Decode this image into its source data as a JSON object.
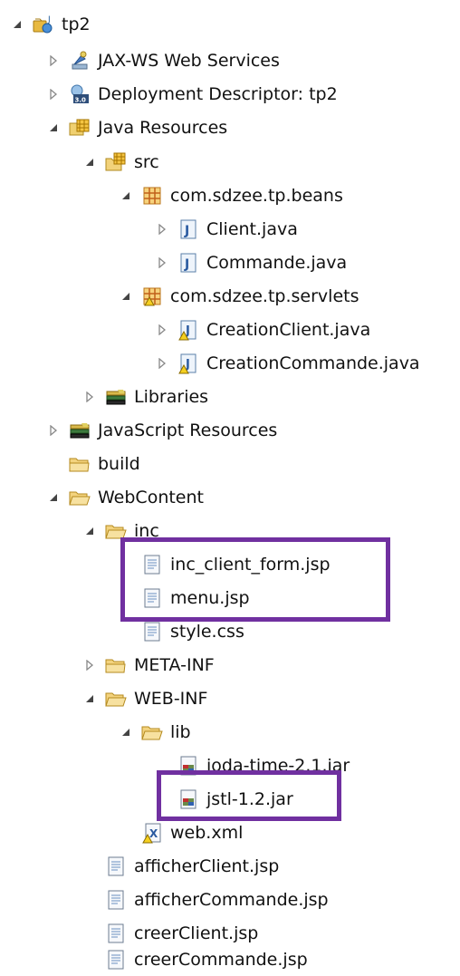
{
  "tree": {
    "project": "tp2",
    "jaxws": "JAX-WS Web Services",
    "deploy": "Deployment Descriptor: tp2",
    "javares": "Java Resources",
    "src": "src",
    "pkg_beans": "com.sdzee.tp.beans",
    "client_java": "Client.java",
    "commande_java": "Commande.java",
    "pkg_servlets": "com.sdzee.tp.servlets",
    "creationclient_java": "CreationClient.java",
    "creationcommande_java": "CreationCommande.java",
    "libraries": "Libraries",
    "jsres": "JavaScript Resources",
    "build": "build",
    "webcontent": "WebContent",
    "inc": "inc",
    "inc_client_form": "inc_client_form.jsp",
    "menu_jsp": "menu.jsp",
    "style_css": "style.css",
    "metainf": "META-INF",
    "webinf": "WEB-INF",
    "lib": "lib",
    "joda": "joda-time-2.1.jar",
    "jstl": "jstl-1.2.jar",
    "webxml": "web.xml",
    "afficherclient": "afficherClient.jsp",
    "affichercommande": "afficherCommande.jsp",
    "creerclient": "creerClient.jsp",
    "creercommande": "creerCommande.jsp"
  },
  "highlight_color": "#7030a0",
  "icons": [
    "web-project-icon",
    "web-services-icon",
    "deployment-descriptor-icon",
    "java-resources-icon",
    "source-folder-icon",
    "package-icon",
    "java-file-icon",
    "libraries-icon",
    "folder-icon",
    "jsp-file-icon",
    "jar-file-icon",
    "xml-file-icon"
  ]
}
